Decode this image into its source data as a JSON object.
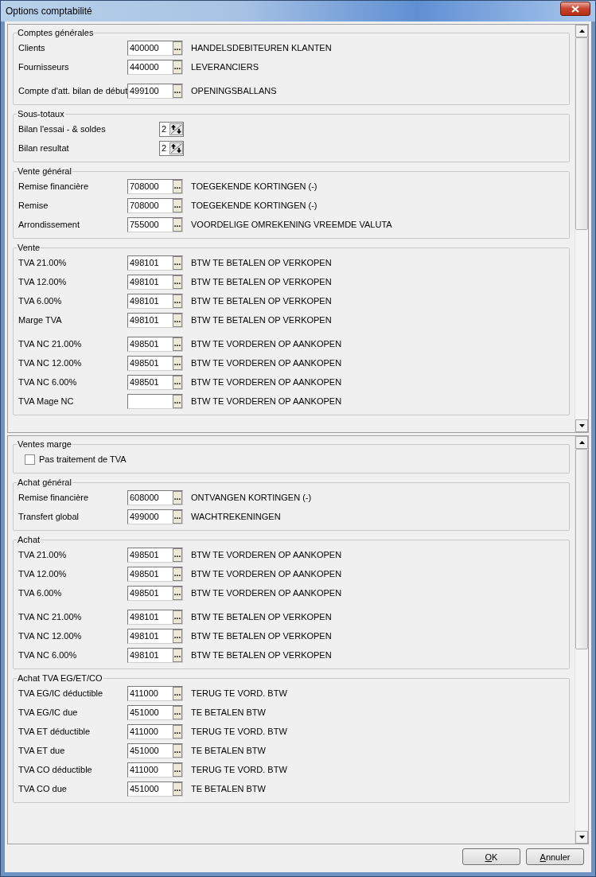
{
  "window": {
    "title": "Options comptabilité"
  },
  "panes": [
    {
      "groups": [
        {
          "title": "Comptes générales",
          "blocks": [
            [
              {
                "kind": "account",
                "label": "Clients",
                "code": "400000",
                "browse": "...",
                "description": "HANDELSDEBITEUREN KLANTEN"
              },
              {
                "kind": "account",
                "label": "Fournisseurs",
                "code": "440000",
                "browse": "...",
                "description": "LEVERANCIERS"
              }
            ],
            [
              {
                "kind": "account",
                "label": "Compte d'att. bilan de début",
                "code": "499100",
                "browse": "...",
                "description": "OPENINGSBALLANS"
              }
            ]
          ]
        },
        {
          "title": "Sous-totaux",
          "blocks": [
            [
              {
                "kind": "spinner",
                "label": "Bilan l'essai - & soldes",
                "value": "2"
              },
              {
                "kind": "spinner",
                "label": "Bilan resultat",
                "value": "2"
              }
            ]
          ]
        },
        {
          "title": "Vente général",
          "blocks": [
            [
              {
                "kind": "account",
                "label": "Remise financière",
                "code": "708000",
                "browse": "...",
                "description": "TOEGEKENDE KORTINGEN (-)"
              },
              {
                "kind": "account",
                "label": "Remise",
                "code": "708000",
                "browse": "...",
                "description": "TOEGEKENDE KORTINGEN (-)"
              },
              {
                "kind": "account",
                "label": "Arrondissement",
                "code": "755000",
                "browse": "...",
                "description": "VOORDELIGE OMREKENING VREEMDE VALUTA"
              }
            ]
          ]
        },
        {
          "title": "Vente",
          "blocks": [
            [
              {
                "kind": "account",
                "label": "TVA 21.00%",
                "code": "498101",
                "browse": "...",
                "description": "BTW TE BETALEN OP VERKOPEN"
              },
              {
                "kind": "account",
                "label": "TVA 12.00%",
                "code": "498101",
                "browse": "...",
                "description": "BTW TE BETALEN OP VERKOPEN"
              },
              {
                "kind": "account",
                "label": "TVA 6.00%",
                "code": "498101",
                "browse": "...",
                "description": "BTW TE BETALEN OP VERKOPEN"
              },
              {
                "kind": "account",
                "label": "Marge TVA",
                "code": "498101",
                "browse": "...",
                "description": "BTW TE BETALEN OP VERKOPEN"
              }
            ],
            [
              {
                "kind": "account",
                "label": "TVA NC 21.00%",
                "code": "498501",
                "browse": "...",
                "description": "BTW TE VORDEREN OP AANKOPEN"
              },
              {
                "kind": "account",
                "label": "TVA NC 12.00%",
                "code": "498501",
                "browse": "...",
                "description": "BTW TE VORDEREN OP AANKOPEN"
              },
              {
                "kind": "account",
                "label": "TVA NC 6.00%",
                "code": "498501",
                "browse": "...",
                "description": "BTW TE VORDEREN OP AANKOPEN"
              },
              {
                "kind": "account",
                "label": "TVA Mage NC",
                "browse": "...",
                "description": "BTW TE VORDEREN OP AANKOPEN"
              }
            ]
          ]
        }
      ]
    },
    {
      "groups": [
        {
          "title": "Ventes marge",
          "blocks": [
            [
              {
                "kind": "checkbox",
                "label": "Pas traitement de TVA",
                "checked": false
              }
            ]
          ]
        },
        {
          "title": "Achat général",
          "blocks": [
            [
              {
                "kind": "account",
                "label": "Remise financière",
                "code": "608000",
                "browse": "...",
                "description": "ONTVANGEN KORTINGEN (-)"
              },
              {
                "kind": "account",
                "label": "Transfert global",
                "code": "499000",
                "browse": "...",
                "description": "WACHTREKENINGEN"
              }
            ]
          ]
        },
        {
          "title": "Achat",
          "blocks": [
            [
              {
                "kind": "account",
                "label": "TVA 21.00%",
                "code": "498501",
                "browse": "...",
                "description": "BTW TE VORDEREN OP AANKOPEN"
              },
              {
                "kind": "account",
                "label": "TVA 12.00%",
                "code": "498501",
                "browse": "...",
                "description": "BTW TE VORDEREN OP AANKOPEN"
              },
              {
                "kind": "account",
                "label": "TVA 6.00%",
                "code": "498501",
                "browse": "...",
                "description": "BTW TE VORDEREN OP AANKOPEN"
              }
            ],
            [
              {
                "kind": "account",
                "label": "TVA NC 21.00%",
                "code": "498101",
                "browse": "...",
                "description": "BTW TE BETALEN OP VERKOPEN"
              },
              {
                "kind": "account",
                "label": "TVA NC 12.00%",
                "code": "498101",
                "browse": "...",
                "description": "BTW TE BETALEN OP VERKOPEN"
              },
              {
                "kind": "account",
                "label": "TVA NC 6.00%",
                "code": "498101",
                "browse": "...",
                "description": "BTW TE BETALEN OP VERKOPEN"
              }
            ]
          ]
        },
        {
          "title": "Achat TVA EG/ET/CO",
          "blocks": [
            [
              {
                "kind": "account",
                "label": "TVA EG/IC déductible",
                "code": "411000",
                "browse": "...",
                "description": "TERUG TE VORD. BTW"
              },
              {
                "kind": "account",
                "label": "TVA EG/IC due",
                "code": "451000",
                "browse": "...",
                "description": "TE BETALEN BTW"
              },
              {
                "kind": "account",
                "label": "TVA ET déductible",
                "code": "411000",
                "browse": "...",
                "description": "TERUG TE VORD. BTW"
              },
              {
                "kind": "account",
                "label": "TVA ET due",
                "code": "451000",
                "browse": "...",
                "description": "TE BETALEN BTW"
              },
              {
                "kind": "account",
                "label": "TVA CO déductible",
                "code": "411000",
                "browse": "...",
                "description": "TERUG TE VORD. BTW"
              },
              {
                "kind": "account",
                "label": "TVA CO due",
                "code": "451000",
                "browse": "...",
                "description": "TE BETALEN BTW"
              }
            ]
          ]
        }
      ]
    }
  ],
  "buttons": [
    {
      "label": "OK"
    },
    {
      "label": "Annuler"
    }
  ]
}
